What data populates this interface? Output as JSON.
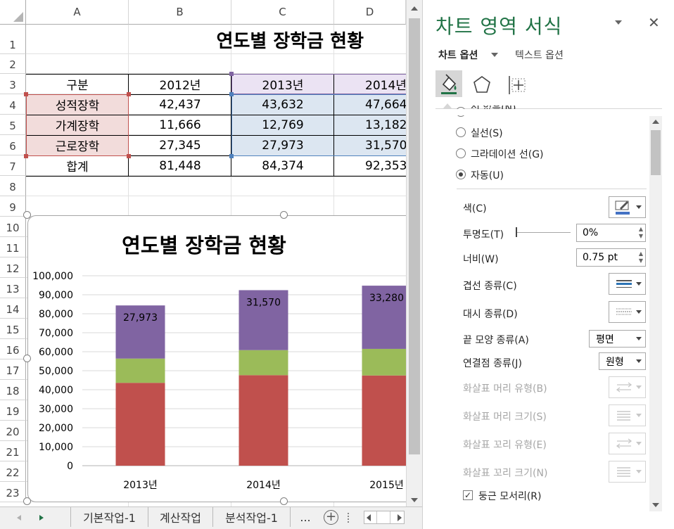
{
  "sheet": {
    "columns": [
      "A",
      "B",
      "C",
      "D"
    ],
    "rows": [
      "1",
      "2",
      "3",
      "4",
      "5",
      "6",
      "7",
      "8",
      "9",
      "10",
      "11",
      "12",
      "13",
      "14",
      "15",
      "16",
      "17",
      "18",
      "19",
      "20",
      "21",
      "22",
      "23"
    ],
    "title": "연도별 장학금 현황",
    "table": {
      "header": [
        "구분",
        "2012년",
        "2013년",
        "2014년"
      ],
      "rows": [
        [
          "성적장학",
          "42,437",
          "43,632",
          "47,664"
        ],
        [
          "가계장학",
          "11,666",
          "12,769",
          "13,182"
        ],
        [
          "근로장학",
          "27,345",
          "27,973",
          "31,570"
        ],
        [
          "합계",
          "81,448",
          "84,374",
          "92,353"
        ]
      ]
    },
    "tabs": [
      "기본작업-1",
      "계산작업",
      "분석작업-1",
      "..."
    ],
    "colors": {
      "highlight_pink": "#f2dcdb",
      "highlight_blue": "#dce6f1",
      "range_purple": "#7f6aa6",
      "range_red": "#c0504d",
      "range_blue": "#4f81bd"
    }
  },
  "chart_data": {
    "type": "bar",
    "stacked": true,
    "title": "연도별 장학금 현황",
    "categories": [
      "2013년",
      "2014년",
      "2015년"
    ],
    "series": [
      {
        "values": [
          43632,
          47664,
          47500
        ],
        "color": "#c0504d"
      },
      {
        "values": [
          12769,
          13182,
          14000
        ],
        "color": "#9bbb59"
      },
      {
        "values": [
          27973,
          31570,
          33280
        ],
        "color": "#8064a2"
      }
    ],
    "data_labels": [
      "27,973",
      "31,570",
      "33,280"
    ],
    "ylim": [
      0,
      100000
    ],
    "yticks": [
      "0",
      "10,000",
      "20,000",
      "30,000",
      "40,000",
      "50,000",
      "60,000",
      "70,000",
      "80,000",
      "90,000",
      "100,000"
    ],
    "grid": true,
    "legend": "none"
  },
  "pane": {
    "title": "차트 영역 서식",
    "tab_chart_options": "차트 옵션",
    "tab_text_options": "텍스트 옵션",
    "icons": [
      "fill-line-icon",
      "effects-pentagon-icon",
      "size-properties-icon"
    ],
    "radio_partial": "선 없음(N)",
    "radio_solid": "실선(S)",
    "radio_gradient": "그라데이션 선(G)",
    "radio_auto": "자동(U)",
    "color_label": "색(C)",
    "transparency_label": "투명도(T)",
    "transparency_value": "0%",
    "width_label": "너비(W)",
    "width_value": "0.75 pt",
    "compound_label": "겹선 종류(C)",
    "dash_label": "대시 종류(D)",
    "cap_label": "끝 모양 종류(A)",
    "cap_value": "평면",
    "join_label": "연결점 종류(J)",
    "join_value": "원형",
    "begin_arrow_type": "화살표 머리 유형(B)",
    "begin_arrow_size": "화살표 머리 크기(S)",
    "end_arrow_type": "화살표 꼬리 유형(E)",
    "end_arrow_size": "화살표 꼬리 크기(N)",
    "rounded_label": "둥근 모서리(R)",
    "accent": "#217346"
  }
}
